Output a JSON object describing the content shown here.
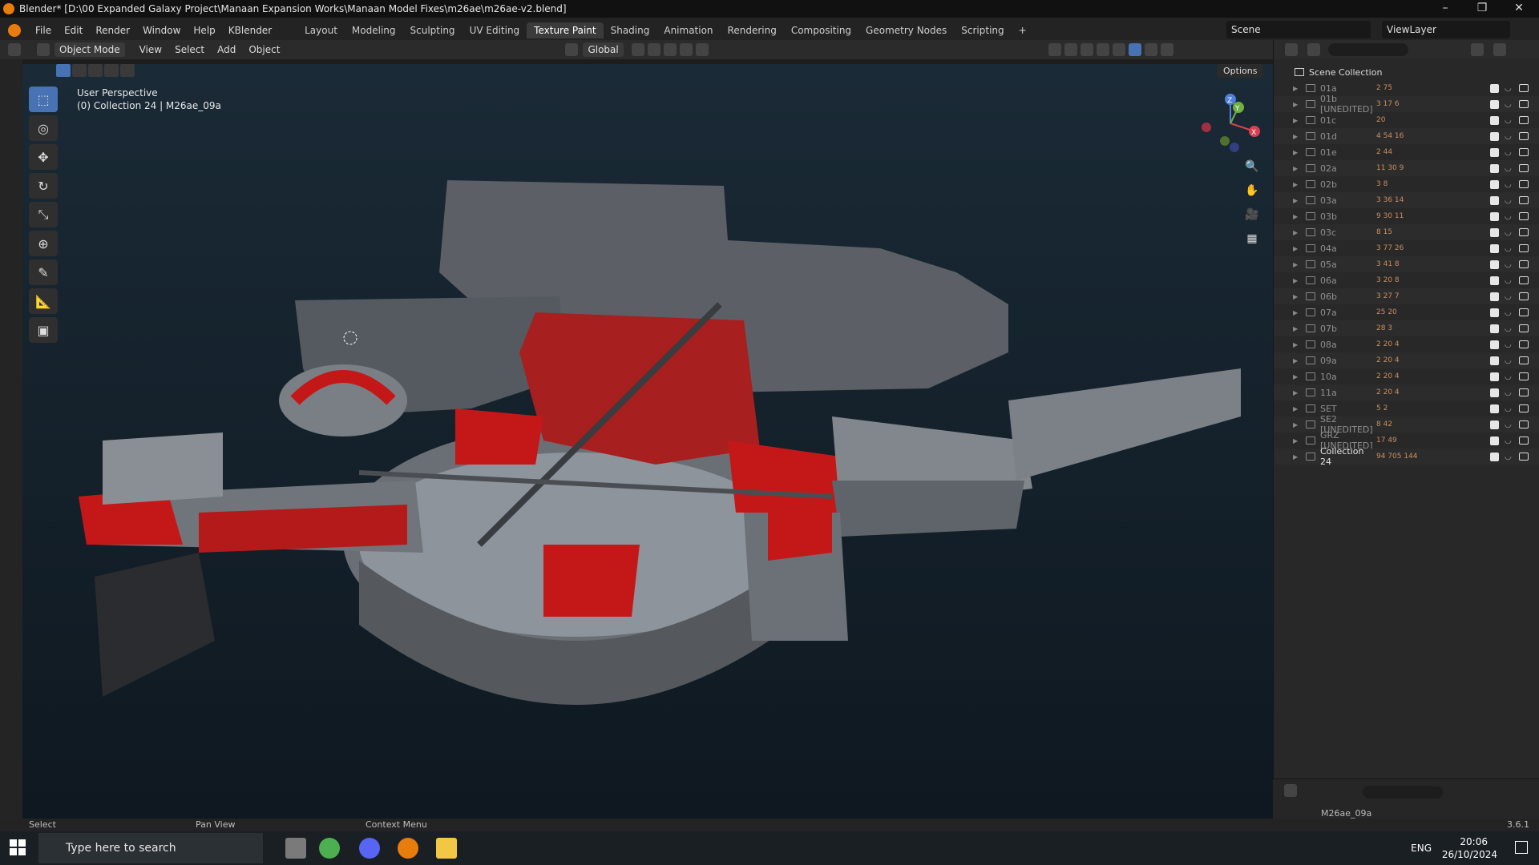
{
  "window": {
    "title": "Blender* [D:\\00 Expanded Galaxy Project\\Manaan Expansion Works\\Manaan Model Fixes\\m26ae\\m26ae-v2.blend]"
  },
  "menu": [
    "File",
    "Edit",
    "Render",
    "Window",
    "Help",
    "KBlender"
  ],
  "workspaces": [
    "Layout",
    "Modeling",
    "Sculpting",
    "UV Editing",
    "Texture Paint",
    "Shading",
    "Animation",
    "Rendering",
    "Compositing",
    "Geometry Nodes",
    "Scripting",
    "+"
  ],
  "active_workspace": "Texture Paint",
  "scene": {
    "label": "Scene",
    "view_layer": "ViewLayer"
  },
  "viewport_header": {
    "mode": "Object Mode",
    "menus": [
      "View",
      "Select",
      "Add",
      "Object"
    ],
    "orientation": "Global",
    "options": "Options"
  },
  "viewport": {
    "perspective": "User Perspective",
    "collection_info": "(0) Collection 24 | M26ae_09a",
    "gizmo_axes": {
      "z": "Z",
      "y": "Y",
      "x": "X"
    }
  },
  "outliner": {
    "root": "Scene Collection",
    "rows": [
      {
        "name": "01a",
        "stats": "2 75"
      },
      {
        "name": "01b [UNEDITED]",
        "stats": "3 17 6"
      },
      {
        "name": "01c",
        "stats": "20"
      },
      {
        "name": "01d",
        "stats": "4 54 16"
      },
      {
        "name": "01e",
        "stats": "2 44"
      },
      {
        "name": "02a",
        "stats": "11 30 9"
      },
      {
        "name": "02b",
        "stats": "3 8"
      },
      {
        "name": "03a",
        "stats": "3 36 14"
      },
      {
        "name": "03b",
        "stats": "9 30 11"
      },
      {
        "name": "03c",
        "stats": "8 15"
      },
      {
        "name": "04a",
        "stats": "3 77 26"
      },
      {
        "name": "05a",
        "stats": "3 41 8"
      },
      {
        "name": "06a",
        "stats": "3 20 8"
      },
      {
        "name": "06b",
        "stats": "3 27 7"
      },
      {
        "name": "07a",
        "stats": "25 20"
      },
      {
        "name": "07b",
        "stats": "28 3"
      },
      {
        "name": "08a",
        "stats": "2 20 4"
      },
      {
        "name": "09a",
        "stats": "2 20 4"
      },
      {
        "name": "10a",
        "stats": "2 20 4"
      },
      {
        "name": "11a",
        "stats": "2 20 4"
      },
      {
        "name": "SET",
        "stats": "5 2"
      },
      {
        "name": "SE2 [UNEDITED]",
        "stats": "8 42"
      },
      {
        "name": "GRZ [UNEDITED]",
        "stats": "17 49"
      },
      {
        "name": "Collection 24",
        "stats": "94 705 144"
      }
    ]
  },
  "properties": {
    "item": "M26ae_09a"
  },
  "status": {
    "select": "Select",
    "pan": "Pan View",
    "context": "Context Menu",
    "version": "3.6.1"
  },
  "taskbar": {
    "search_placeholder": "Type here to search",
    "lang": "ENG",
    "time": "20:06",
    "date": "26/10/2024"
  }
}
